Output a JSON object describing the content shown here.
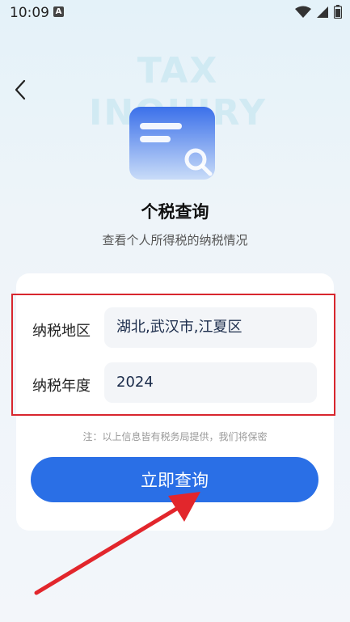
{
  "status_bar": {
    "time": "10:09",
    "notification_glyph": "A"
  },
  "watermark": {
    "line1": "TAX",
    "line2": "INQUIRY"
  },
  "header": {
    "title": "个税查询",
    "subtitle": "查看个人所得税的纳税情况"
  },
  "form": {
    "region_label": "纳税地区",
    "region_value": "湖北,武汉市,江夏区",
    "year_label": "纳税年度",
    "year_value": "2024"
  },
  "note": "注：以上信息皆有税务局提供，我们将保密",
  "query_button": "立即查询",
  "colors": {
    "primary": "#2a6fe6",
    "highlight": "#d8262e",
    "arrow": "#e2262c"
  },
  "icons": [
    "back-chevron-icon",
    "document-search-icon",
    "wifi-icon",
    "signal-icon",
    "battery-icon"
  ]
}
